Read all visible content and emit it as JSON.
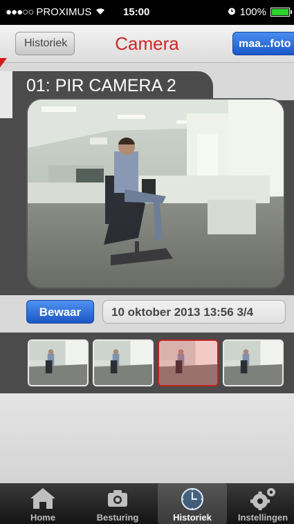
{
  "status_bar": {
    "signal": "●●●○○",
    "carrier": "PROXIMUS",
    "time": "15:00",
    "battery": "100%",
    "battery_level": 1.0
  },
  "navbar": {
    "back_label": "Historiek",
    "title": "Camera",
    "photo_button_label": "maa...foto"
  },
  "camera": {
    "name": "01: PIR CAMERA 2"
  },
  "controls": {
    "save_label": "Bewaar",
    "timestamp": "10 oktober 2013 13:56 3/4"
  },
  "thumbnails": {
    "count": 4,
    "selected_index": 2
  },
  "tabbar": {
    "items": [
      {
        "label": "Home",
        "icon": "home-icon"
      },
      {
        "label": "Besturing",
        "icon": "camera-icon"
      },
      {
        "label": "Historiek",
        "icon": "clock-icon",
        "active": true
      },
      {
        "label": "Instellingen",
        "icon": "gears-icon"
      }
    ]
  },
  "colors": {
    "title_red": "#d02626",
    "button_blue": "#1c56c4",
    "panel_dark": "#4b4b4b"
  }
}
